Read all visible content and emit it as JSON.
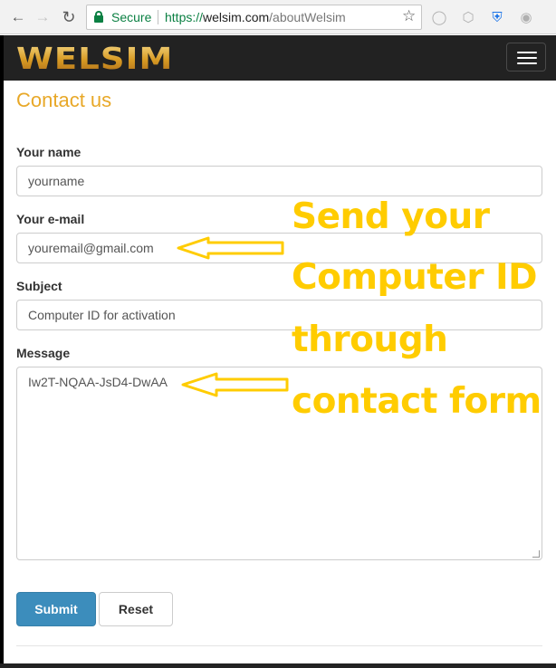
{
  "browser": {
    "secure_label": "Secure",
    "url_scheme": "https://",
    "url_domain": "welsim.com",
    "url_path": "/aboutWelsim",
    "icons": [
      "back-arrow-icon",
      "forward-arrow-icon",
      "reload-icon",
      "lock-icon",
      "star-icon",
      "extension-icons"
    ]
  },
  "navbar": {
    "logo_text": "WELSIM",
    "menu_icon": "hamburger-icon"
  },
  "form": {
    "title": "Contact us",
    "name_label": "Your name",
    "name_placeholder": "yourname",
    "email_label": "Your e-mail",
    "email_placeholder": "youremail@gmail.com",
    "subject_label": "Subject",
    "subject_value": "Computer ID for activation",
    "message_label": "Message",
    "message_value": "Iw2T-NQAA-JsD4-DwAA",
    "submit_label": "Submit",
    "reset_label": "Reset"
  },
  "annotation": {
    "lines": [
      "Send your",
      "Computer ID",
      "through",
      "contact form"
    ],
    "color": "#ffcc00"
  },
  "colors": {
    "accent": "#e8a828",
    "submit_bg": "#3c8dbc",
    "navbar_bg": "#222222"
  }
}
